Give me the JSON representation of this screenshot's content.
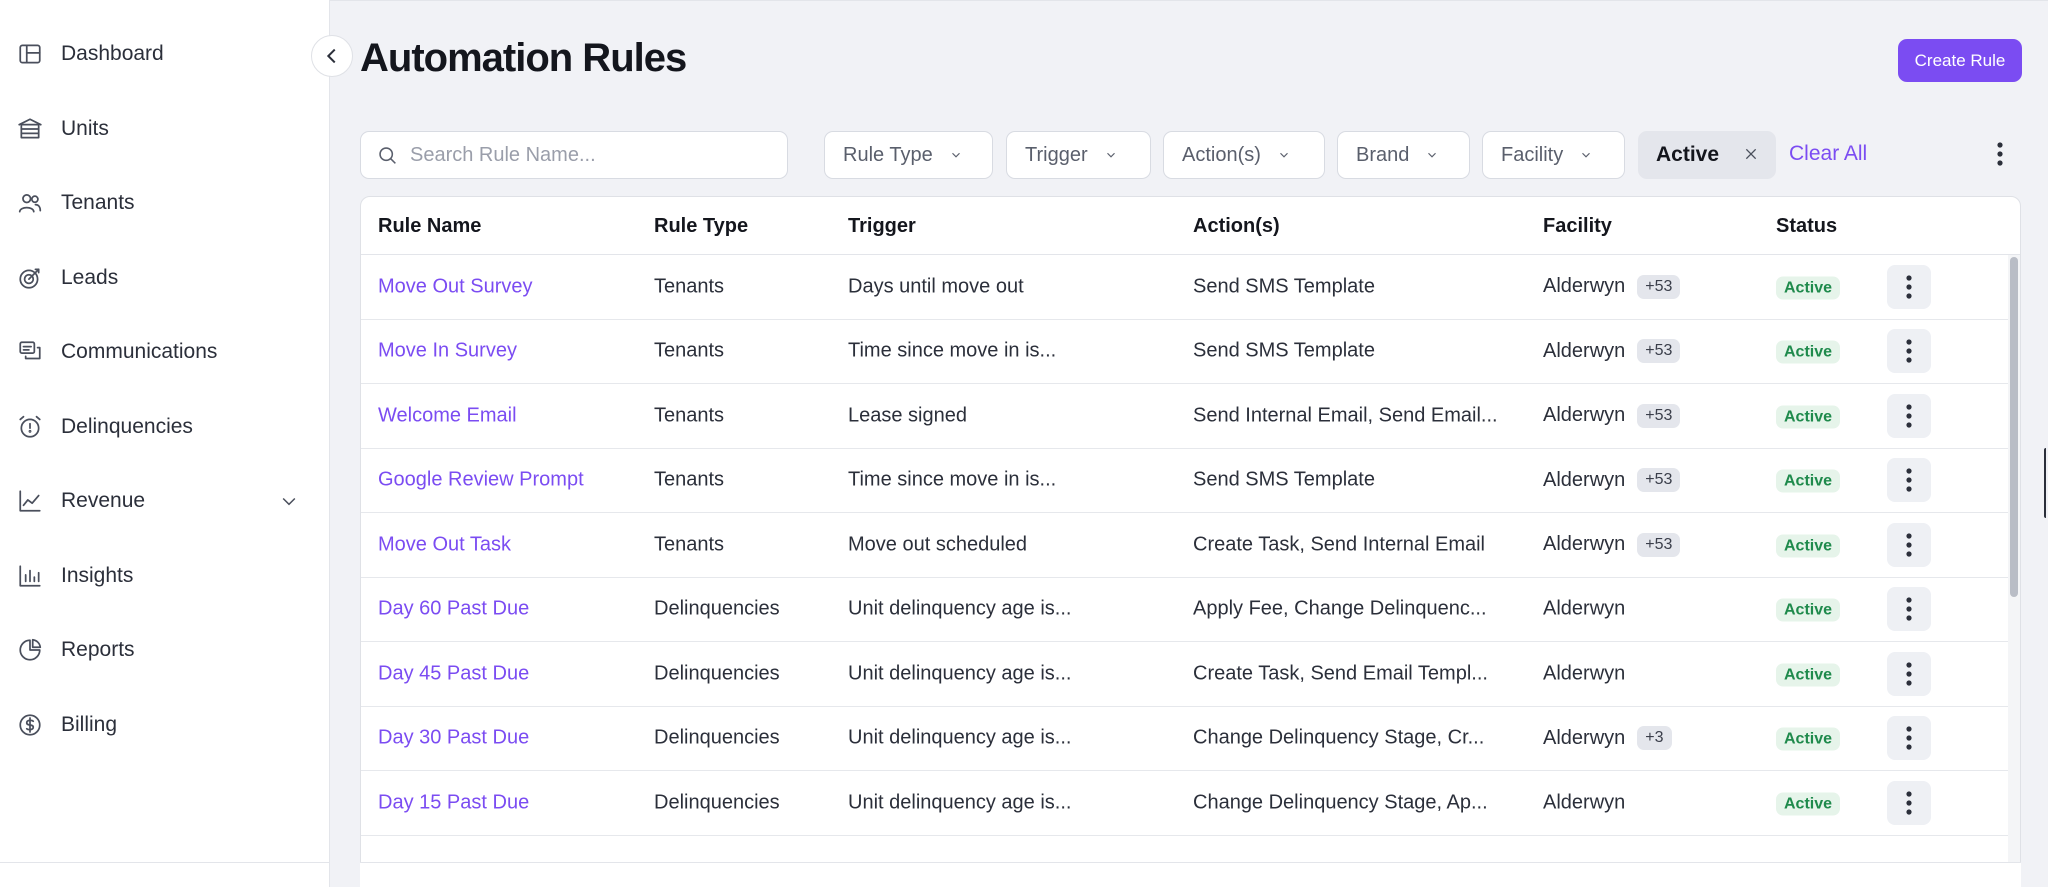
{
  "sidebar": {
    "items": [
      {
        "label": "Dashboard",
        "icon": "dashboard-icon"
      },
      {
        "label": "Units",
        "icon": "units-icon"
      },
      {
        "label": "Tenants",
        "icon": "tenants-icon"
      },
      {
        "label": "Leads",
        "icon": "leads-icon"
      },
      {
        "label": "Communications",
        "icon": "communications-icon"
      },
      {
        "label": "Delinquencies",
        "icon": "alarm-clock-icon"
      },
      {
        "label": "Revenue",
        "icon": "line-chart-icon",
        "expandable": true
      },
      {
        "label": "Insights",
        "icon": "bar-chart-icon"
      },
      {
        "label": "Reports",
        "icon": "pie-chart-icon"
      },
      {
        "label": "Billing",
        "icon": "dollar-circle-icon"
      }
    ]
  },
  "header": {
    "title": "Automation Rules",
    "create_button": "Create Rule"
  },
  "filters": {
    "search_placeholder": "Search Rule Name...",
    "dropdowns": [
      "Rule Type",
      "Trigger",
      "Action(s)",
      "Brand",
      "Facility"
    ],
    "active_chip": "Active",
    "clear_all": "Clear All"
  },
  "table": {
    "columns": [
      "Rule Name",
      "Rule Type",
      "Trigger",
      "Action(s)",
      "Facility",
      "Status"
    ],
    "rows": [
      {
        "name": "Move Out Survey",
        "type": "Tenants",
        "trigger": "Days until move out",
        "actions": "Send SMS Template",
        "facility": "Alderwyn",
        "extra": "+53",
        "status": "Active"
      },
      {
        "name": "Move In Survey",
        "type": "Tenants",
        "trigger": "Time since move in is...",
        "actions": "Send SMS Template",
        "facility": "Alderwyn",
        "extra": "+53",
        "status": "Active"
      },
      {
        "name": "Welcome Email",
        "type": "Tenants",
        "trigger": "Lease signed",
        "actions": "Send Internal Email, Send Email...",
        "facility": "Alderwyn",
        "extra": "+53",
        "status": "Active"
      },
      {
        "name": "Google Review Prompt",
        "type": "Tenants",
        "trigger": "Time since move in is...",
        "actions": "Send SMS Template",
        "facility": "Alderwyn",
        "extra": "+53",
        "status": "Active"
      },
      {
        "name": "Move Out Task",
        "type": "Tenants",
        "trigger": "Move out scheduled",
        "actions": "Create Task, Send Internal Email",
        "facility": "Alderwyn",
        "extra": "+53",
        "status": "Active"
      },
      {
        "name": "Day 60 Past Due",
        "type": "Delinquencies",
        "trigger": "Unit delinquency age is...",
        "actions": "Apply Fee, Change Delinquenc...",
        "facility": "Alderwyn",
        "extra": "",
        "status": "Active"
      },
      {
        "name": "Day 45 Past Due",
        "type": "Delinquencies",
        "trigger": "Unit delinquency age is...",
        "actions": "Create Task, Send Email Templ...",
        "facility": "Alderwyn",
        "extra": "",
        "status": "Active"
      },
      {
        "name": "Day 30 Past Due",
        "type": "Delinquencies",
        "trigger": "Unit delinquency age is...",
        "actions": "Change Delinquency Stage, Cr...",
        "facility": "Alderwyn",
        "extra": "+3",
        "status": "Active"
      },
      {
        "name": "Day 15 Past Due",
        "type": "Delinquencies",
        "trigger": "Unit delinquency age is...",
        "actions": "Change Delinquency Stage, Ap...",
        "facility": "Alderwyn",
        "extra": "",
        "status": "Active"
      }
    ]
  },
  "colors": {
    "accent": "#7b4cf2",
    "status_active_bg": "#e6f4ea",
    "status_active_text": "#1f8a4c"
  }
}
